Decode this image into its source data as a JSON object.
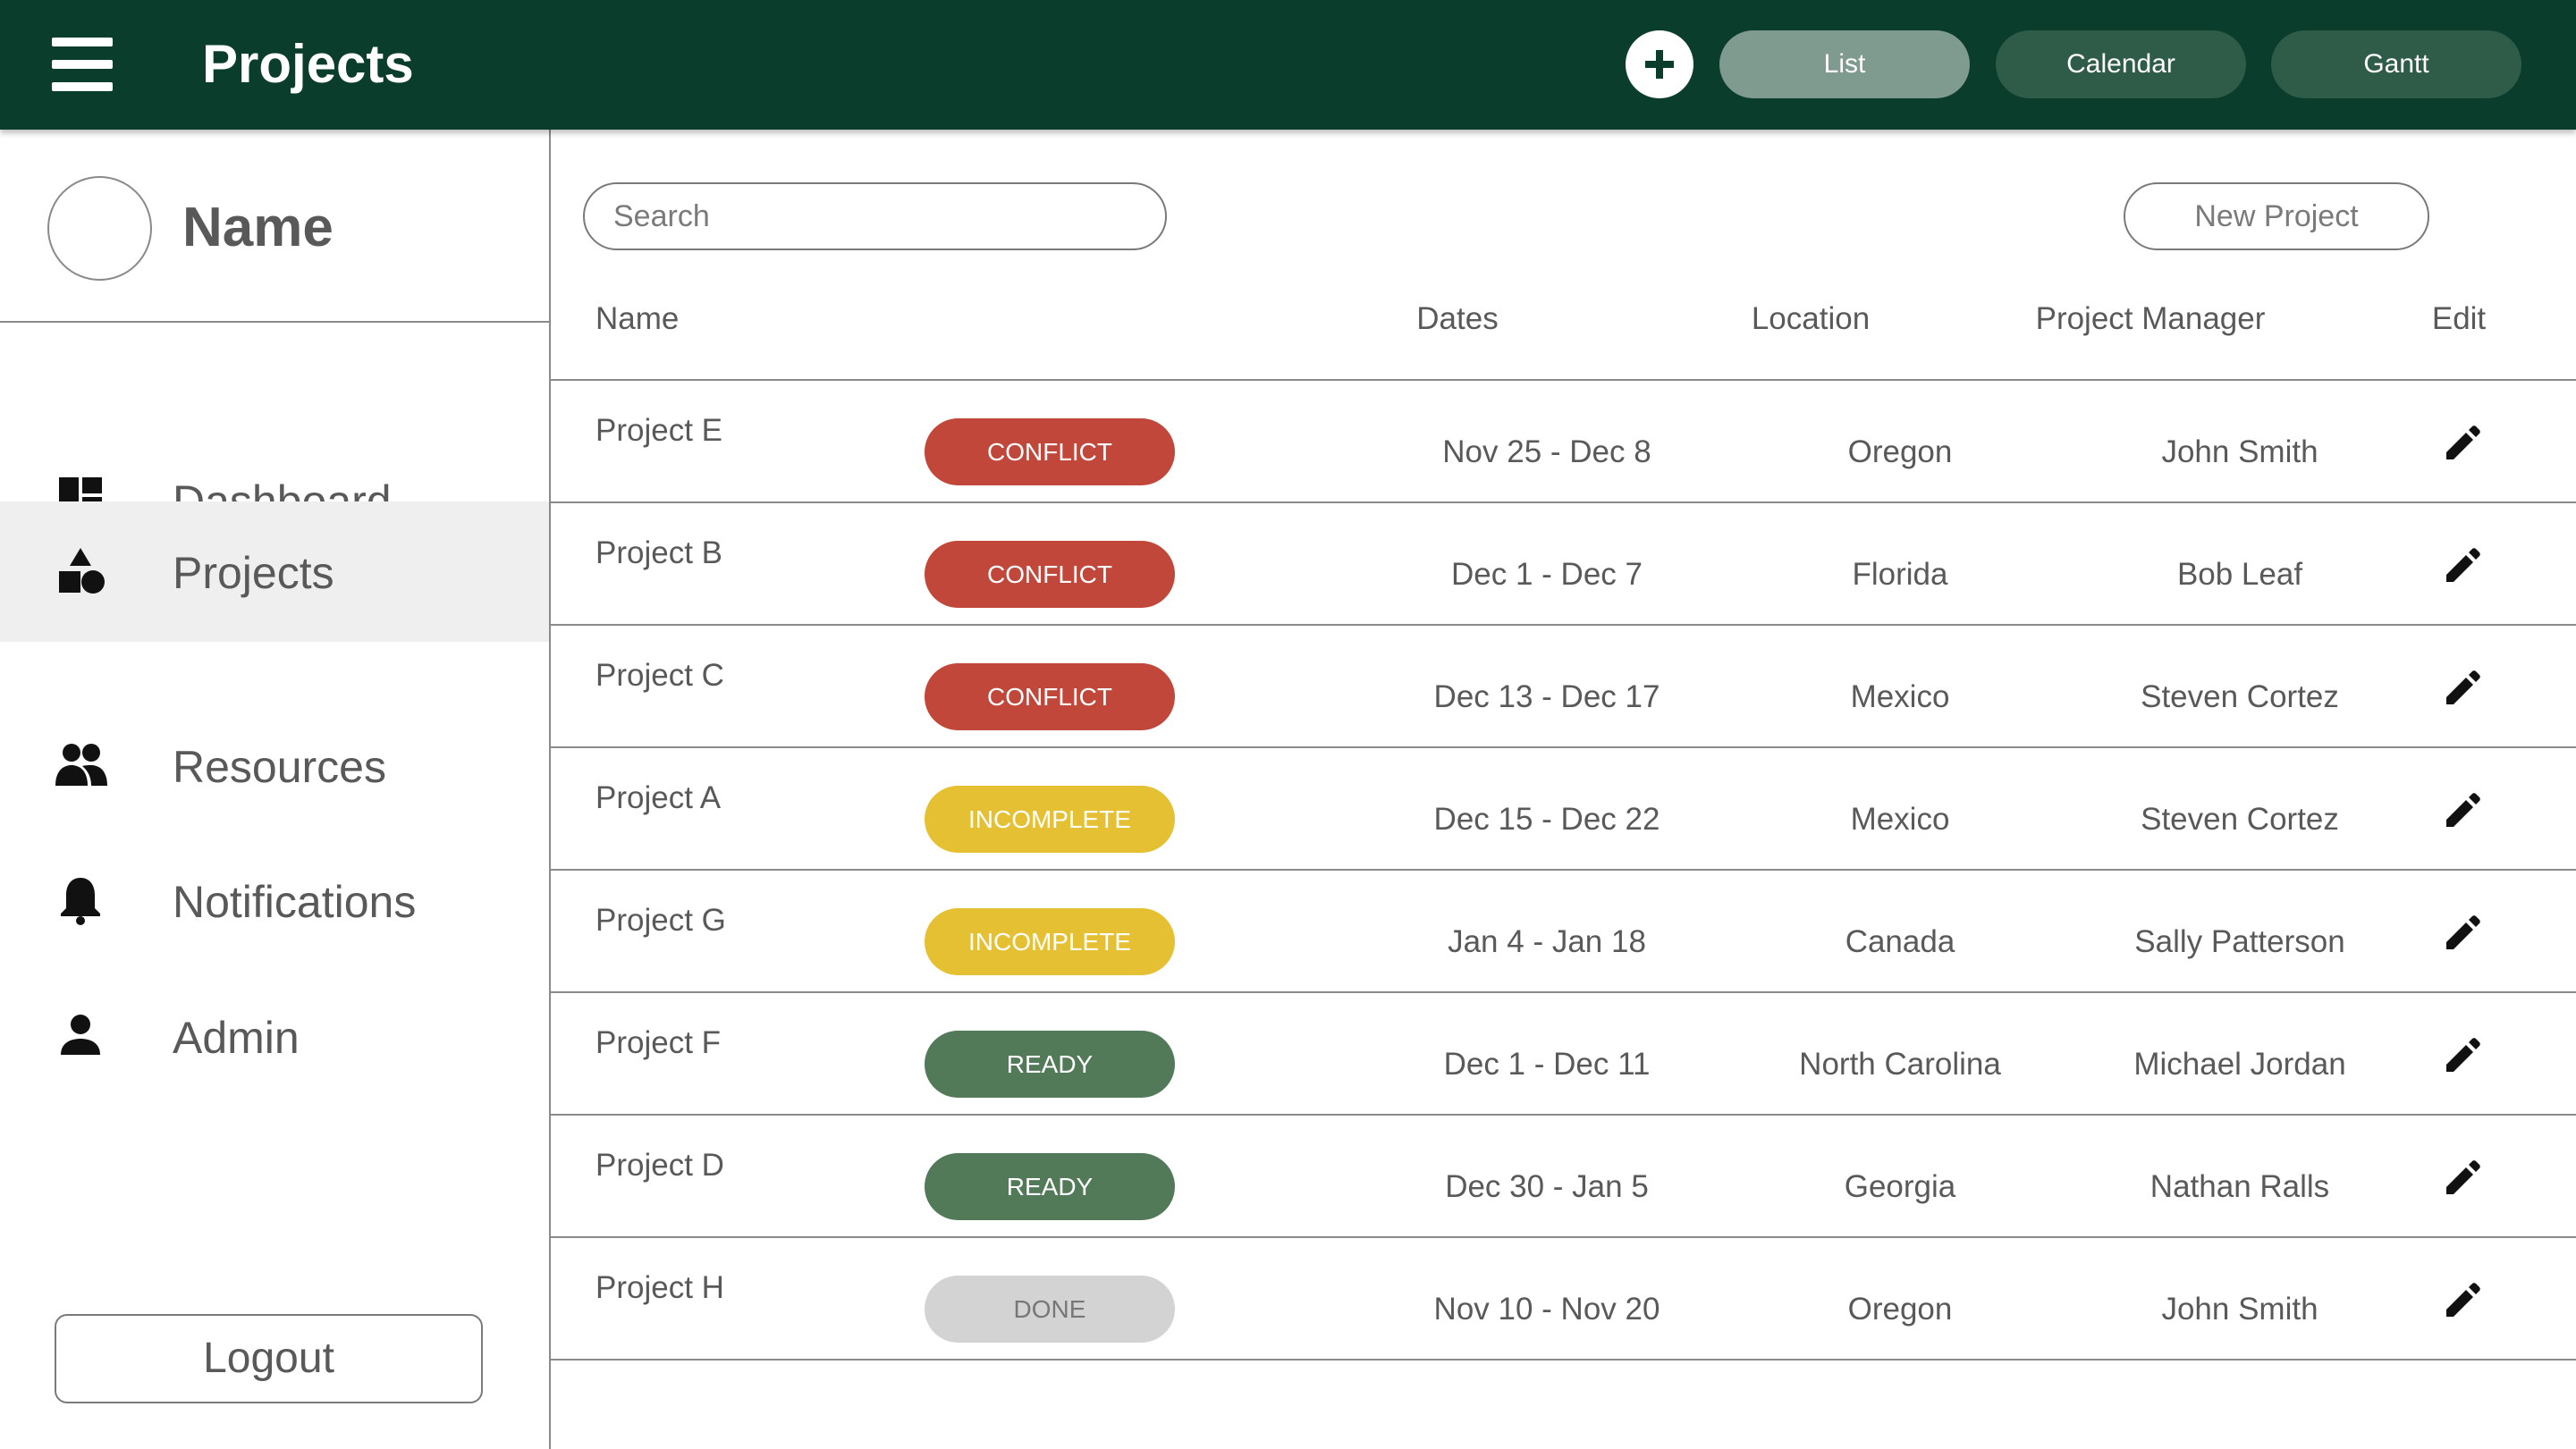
{
  "header": {
    "title": "Projects",
    "menu_icon": "hamburger-menu-icon",
    "add_icon": "plus-icon",
    "views": [
      {
        "label": "List",
        "active": true
      },
      {
        "label": "Calendar",
        "active": false
      },
      {
        "label": "Gantt",
        "active": false
      }
    ]
  },
  "sidebar": {
    "profile_name": "Name",
    "items": [
      {
        "label": "Dashboard",
        "icon": "dashboard-icon",
        "active": false
      },
      {
        "label": "Projects",
        "icon": "shapes-icon",
        "active": true
      },
      {
        "label": "Resources",
        "icon": "people-icon",
        "active": false
      },
      {
        "label": "Notifications",
        "icon": "bell-icon",
        "active": false
      },
      {
        "label": "Admin",
        "icon": "person-icon",
        "active": false
      }
    ],
    "logout_label": "Logout"
  },
  "main": {
    "search_placeholder": "Search",
    "new_project_label": "New Project",
    "columns": {
      "name": "Name",
      "dates": "Dates",
      "location": "Location",
      "manager": "Project Manager",
      "edit": "Edit"
    },
    "rows": [
      {
        "name": "Project E",
        "status": "CONFLICT",
        "dates": "Nov 25 - Dec 8",
        "location": "Oregon",
        "manager": "John Smith"
      },
      {
        "name": "Project B",
        "status": "CONFLICT",
        "dates": "Dec 1 - Dec 7",
        "location": "Florida",
        "manager": "Bob Leaf"
      },
      {
        "name": "Project C",
        "status": "CONFLICT",
        "dates": "Dec 13 - Dec 17",
        "location": "Mexico",
        "manager": "Steven Cortez"
      },
      {
        "name": "Project A",
        "status": "INCOMPLETE",
        "dates": "Dec 15 - Dec 22",
        "location": "Mexico",
        "manager": "Steven Cortez"
      },
      {
        "name": "Project G",
        "status": "INCOMPLETE",
        "dates": "Jan 4 - Jan 18",
        "location": "Canada",
        "manager": "Sally Patterson"
      },
      {
        "name": "Project F",
        "status": "READY",
        "dates": "Dec 1 - Dec 11",
        "location": "North Carolina",
        "manager": "Michael Jordan"
      },
      {
        "name": "Project D",
        "status": "READY",
        "dates": "Dec 30 - Jan 5",
        "location": "Georgia",
        "manager": "Nathan Ralls"
      },
      {
        "name": "Project H",
        "status": "DONE",
        "dates": "Nov 10 - Nov 20",
        "location": "Oregon",
        "manager": "John Smith"
      }
    ]
  },
  "colors": {
    "header_bg": "#0b3d2c",
    "conflict": "#c1473a",
    "incomplete": "#e6c033",
    "ready": "#527a59",
    "done": "#d3d3d3"
  }
}
